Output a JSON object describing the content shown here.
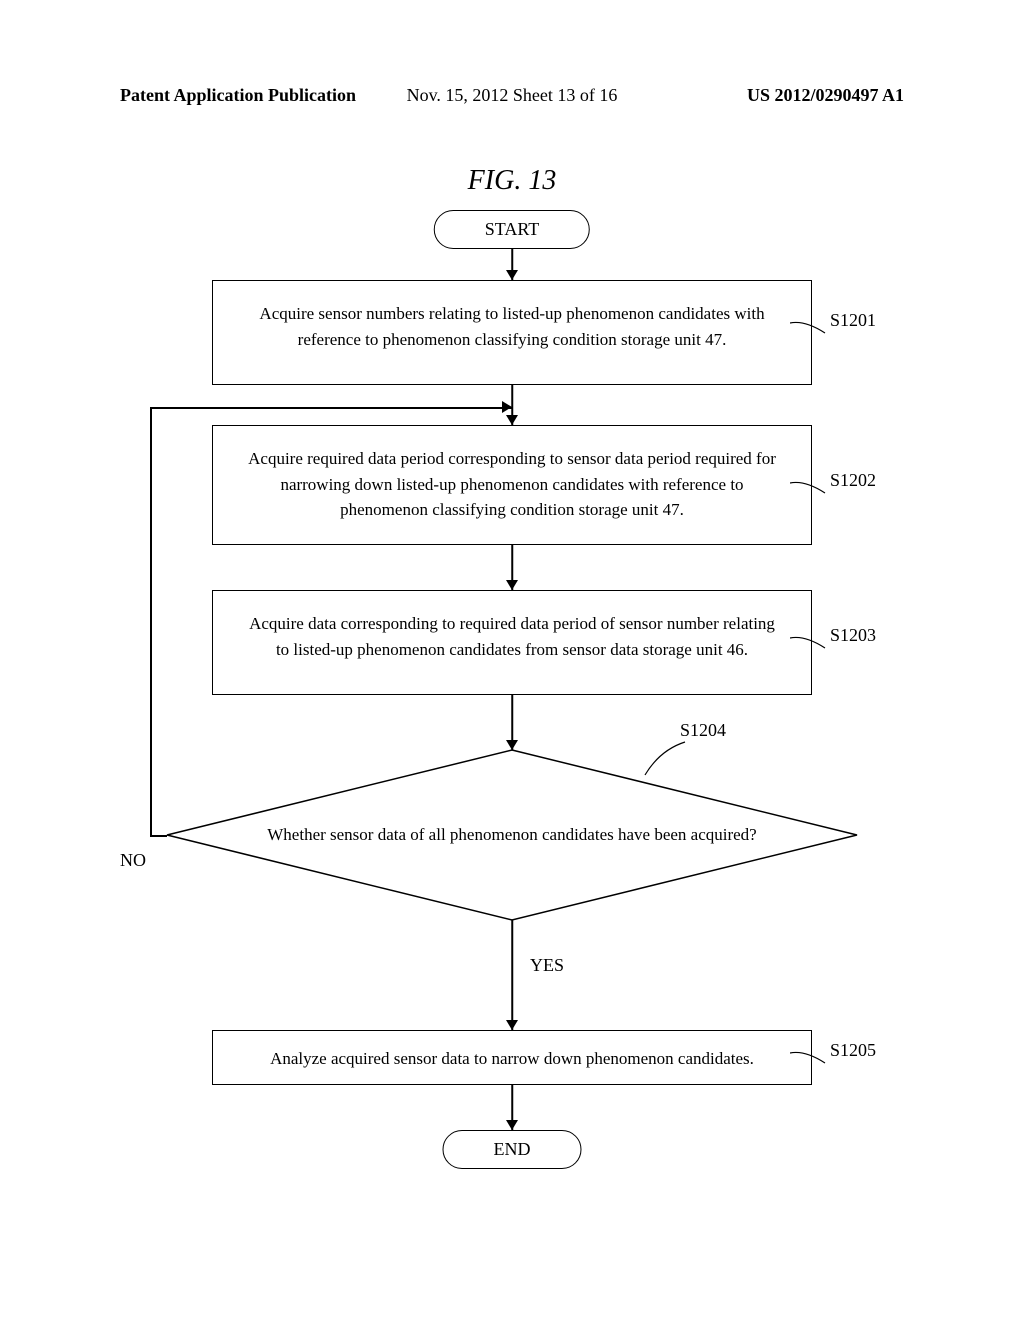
{
  "header": {
    "left": "Patent Application Publication",
    "center": "Nov. 15, 2012  Sheet 13 of 16",
    "right": "US 2012/0290497 A1"
  },
  "figure_title": "FIG.  13",
  "flowchart": {
    "start": "START",
    "end": "END",
    "step1": {
      "text": "Acquire sensor numbers relating to listed-up phenomenon candidates with reference to phenomenon classifying condition storage unit 47.",
      "label": "S1201"
    },
    "step2": {
      "text": "Acquire required data period corresponding to sensor data period required for narrowing down listed-up phenomenon candidates with reference to phenomenon classifying condition storage unit 47.",
      "label": "S1202"
    },
    "step3": {
      "text": "Acquire data corresponding to required data period of sensor number relating to listed-up phenomenon candidates from sensor data storage unit 46.",
      "label": "S1203"
    },
    "decision": {
      "text": "Whether sensor data of all phenomenon candidates have been acquired?",
      "label": "S1204",
      "no": "NO",
      "yes": "YES"
    },
    "step5": {
      "text": "Analyze acquired sensor data to narrow down phenomenon candidates.",
      "label": "S1205"
    }
  },
  "chart_data": {
    "type": "flowchart",
    "nodes": [
      {
        "id": "start",
        "type": "terminal",
        "text": "START"
      },
      {
        "id": "s1201",
        "type": "process",
        "text": "Acquire sensor numbers relating to listed-up phenomenon candidates with reference to phenomenon classifying condition storage unit 47.",
        "label": "S1201"
      },
      {
        "id": "s1202",
        "type": "process",
        "text": "Acquire required data period corresponding to sensor data period required for narrowing down listed-up phenomenon candidates with reference to phenomenon classifying condition storage unit 47.",
        "label": "S1202"
      },
      {
        "id": "s1203",
        "type": "process",
        "text": "Acquire data corresponding to required data period of sensor number relating to listed-up phenomenon candidates from sensor data storage unit 46.",
        "label": "S1203"
      },
      {
        "id": "s1204",
        "type": "decision",
        "text": "Whether sensor data of all phenomenon candidates have been acquired?",
        "label": "S1204"
      },
      {
        "id": "s1205",
        "type": "process",
        "text": "Analyze acquired sensor data to narrow down phenomenon candidates.",
        "label": "S1205"
      },
      {
        "id": "end",
        "type": "terminal",
        "text": "END"
      }
    ],
    "edges": [
      {
        "from": "start",
        "to": "s1201"
      },
      {
        "from": "s1201",
        "to": "s1202"
      },
      {
        "from": "s1202",
        "to": "s1203"
      },
      {
        "from": "s1203",
        "to": "s1204"
      },
      {
        "from": "s1204",
        "to": "s1205",
        "label": "YES"
      },
      {
        "from": "s1204",
        "to": "s1202",
        "label": "NO"
      },
      {
        "from": "s1205",
        "to": "end"
      }
    ]
  }
}
